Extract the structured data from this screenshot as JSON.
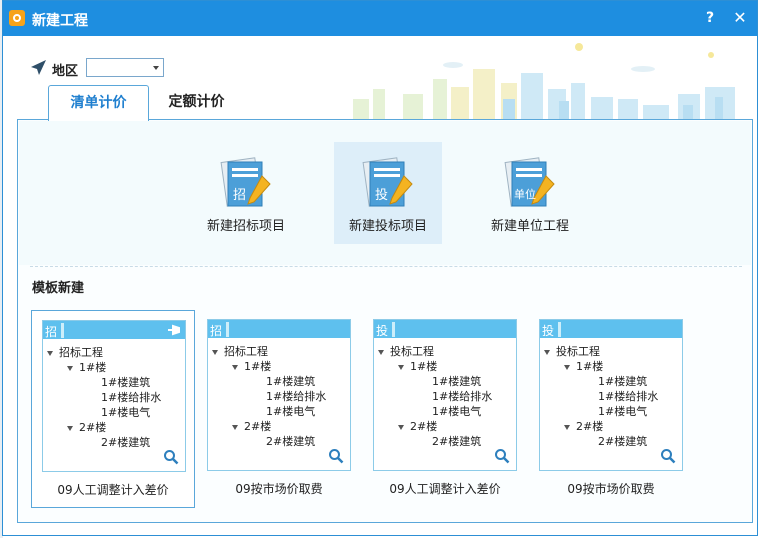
{
  "window": {
    "title": "新建工程",
    "help": "?",
    "close": "✕"
  },
  "region": {
    "label": "地区",
    "value": ""
  },
  "tabs": [
    {
      "label": "清单计价",
      "active": true
    },
    {
      "label": "定额计价",
      "active": false
    }
  ],
  "project_buttons": [
    {
      "label": "新建招标项目",
      "doc_char": "招",
      "selected": false
    },
    {
      "label": "新建投标项目",
      "doc_char": "投",
      "selected": true
    },
    {
      "label": "新建单位工程",
      "doc_char": "单位",
      "selected": false
    }
  ],
  "template_section": {
    "title": "模板新建"
  },
  "templates": [
    {
      "tag": "招",
      "root": "招标工程",
      "building1": "1#楼",
      "b1_items": [
        "1#楼建筑",
        "1#楼给排水",
        "1#楼电气"
      ],
      "building2": "2#楼",
      "b2_items": [
        "2#楼建筑"
      ],
      "caption": "09人工调整计入差价",
      "selected": true
    },
    {
      "tag": "招",
      "root": "招标工程",
      "building1": "1#楼",
      "b1_items": [
        "1#楼建筑",
        "1#楼给排水",
        "1#楼电气"
      ],
      "building2": "2#楼",
      "b2_items": [
        "2#楼建筑"
      ],
      "caption": "09按市场价取费",
      "selected": false
    },
    {
      "tag": "投",
      "root": "投标工程",
      "building1": "1#楼",
      "b1_items": [
        "1#楼建筑",
        "1#楼给排水",
        "1#楼电气"
      ],
      "building2": "2#楼",
      "b2_items": [
        "2#楼建筑"
      ],
      "caption": "09人工调整计入差价",
      "selected": false
    },
    {
      "tag": "投",
      "root": "投标工程",
      "building1": "1#楼",
      "b1_items": [
        "1#楼建筑",
        "1#楼给排水",
        "1#楼电气"
      ],
      "building2": "2#楼",
      "b2_items": [
        "2#楼建筑"
      ],
      "caption": "09按市场价取费",
      "selected": false
    }
  ],
  "colors": {
    "titlebar": "#1e8ee0",
    "accent": "#1f7fcf",
    "card_header": "#5ec0ee",
    "selected_bg": "#ddeef9"
  }
}
